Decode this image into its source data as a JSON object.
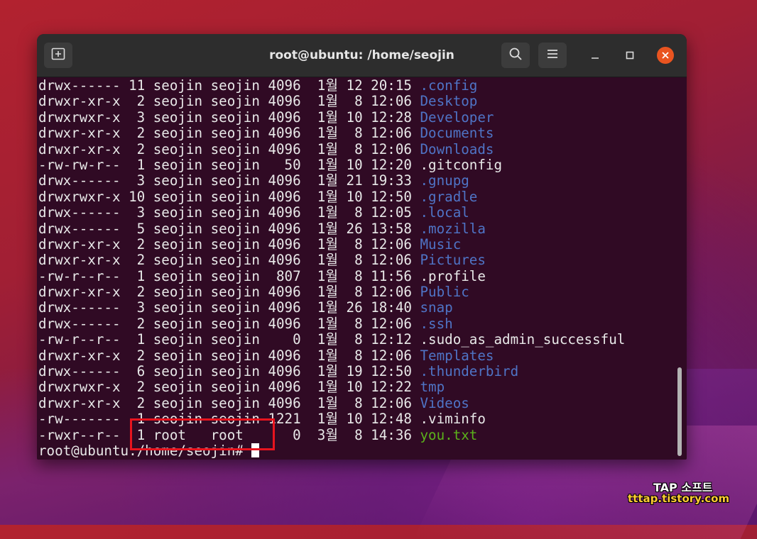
{
  "window": {
    "title": "root@ubuntu: /home/seojin",
    "new_tab_icon": "new-tab-icon",
    "search_icon": "search-icon",
    "menu_icon": "hamburger-menu-icon",
    "minimize_glyph": "–",
    "maximize_glyph": "▢",
    "close_glyph": "✕"
  },
  "colors": {
    "directory": "#4f74c6",
    "executable": "#5bb21b",
    "terminal_bg": "#300a24",
    "close": "#e95420",
    "highlight_box": "#e8141e"
  },
  "listing": [
    {
      "meta": "drwx------ 11 seojin seojin 4096  1월 12 20:15 ",
      "name": ".config",
      "kind": "dir"
    },
    {
      "meta": "drwxr-xr-x  2 seojin seojin 4096  1월  8 12:06 ",
      "name": "Desktop",
      "kind": "dir"
    },
    {
      "meta": "drwxrwxr-x  3 seojin seojin 4096  1월 10 12:28 ",
      "name": "Developer",
      "kind": "dir"
    },
    {
      "meta": "drwxr-xr-x  2 seojin seojin 4096  1월  8 12:06 ",
      "name": "Documents",
      "kind": "dir"
    },
    {
      "meta": "drwxr-xr-x  2 seojin seojin 4096  1월  8 12:06 ",
      "name": "Downloads",
      "kind": "dir"
    },
    {
      "meta": "-rw-rw-r--  1 seojin seojin   50  1월 10 12:20 ",
      "name": ".gitconfig",
      "kind": "file"
    },
    {
      "meta": "drwx------  3 seojin seojin 4096  1월 21 19:33 ",
      "name": ".gnupg",
      "kind": "dir"
    },
    {
      "meta": "drwxrwxr-x 10 seojin seojin 4096  1월 10 12:50 ",
      "name": ".gradle",
      "kind": "dir"
    },
    {
      "meta": "drwx------  3 seojin seojin 4096  1월  8 12:05 ",
      "name": ".local",
      "kind": "dir"
    },
    {
      "meta": "drwx------  5 seojin seojin 4096  1월 26 13:58 ",
      "name": ".mozilla",
      "kind": "dir"
    },
    {
      "meta": "drwxr-xr-x  2 seojin seojin 4096  1월  8 12:06 ",
      "name": "Music",
      "kind": "dir"
    },
    {
      "meta": "drwxr-xr-x  2 seojin seojin 4096  1월  8 12:06 ",
      "name": "Pictures",
      "kind": "dir"
    },
    {
      "meta": "-rw-r--r--  1 seojin seojin  807  1월  8 11:56 ",
      "name": ".profile",
      "kind": "file"
    },
    {
      "meta": "drwxr-xr-x  2 seojin seojin 4096  1월  8 12:06 ",
      "name": "Public",
      "kind": "dir"
    },
    {
      "meta": "drwx------  3 seojin seojin 4096  1월 26 18:40 ",
      "name": "snap",
      "kind": "dir"
    },
    {
      "meta": "drwx------  2 seojin seojin 4096  1월  8 12:06 ",
      "name": ".ssh",
      "kind": "dir"
    },
    {
      "meta": "-rw-r--r--  1 seojin seojin    0  1월  8 12:12 ",
      "name": ".sudo_as_admin_successful",
      "kind": "file"
    },
    {
      "meta": "drwxr-xr-x  2 seojin seojin 4096  1월  8 12:06 ",
      "name": "Templates",
      "kind": "dir"
    },
    {
      "meta": "drwx------  6 seojin seojin 4096  1월 19 12:50 ",
      "name": ".thunderbird",
      "kind": "dir"
    },
    {
      "meta": "drwxrwxr-x  2 seojin seojin 4096  1월 10 12:22 ",
      "name": "tmp",
      "kind": "dir"
    },
    {
      "meta": "drwxr-xr-x  2 seojin seojin 4096  1월  8 12:06 ",
      "name": "Videos",
      "kind": "dir"
    },
    {
      "meta": "-rw-------  1 seojin seojin 1221  1월 10 12:48 ",
      "name": ".viminfo",
      "kind": "file"
    },
    {
      "meta": "-rwxr--r--  1 root   root      0  3월  8 14:36 ",
      "name": "you.txt",
      "kind": "exe"
    }
  ],
  "prompt": "root@ubuntu:/home/seojin# ",
  "watermark": {
    "brand": "TAP 소프트",
    "site": "tttap.tistory.com"
  }
}
